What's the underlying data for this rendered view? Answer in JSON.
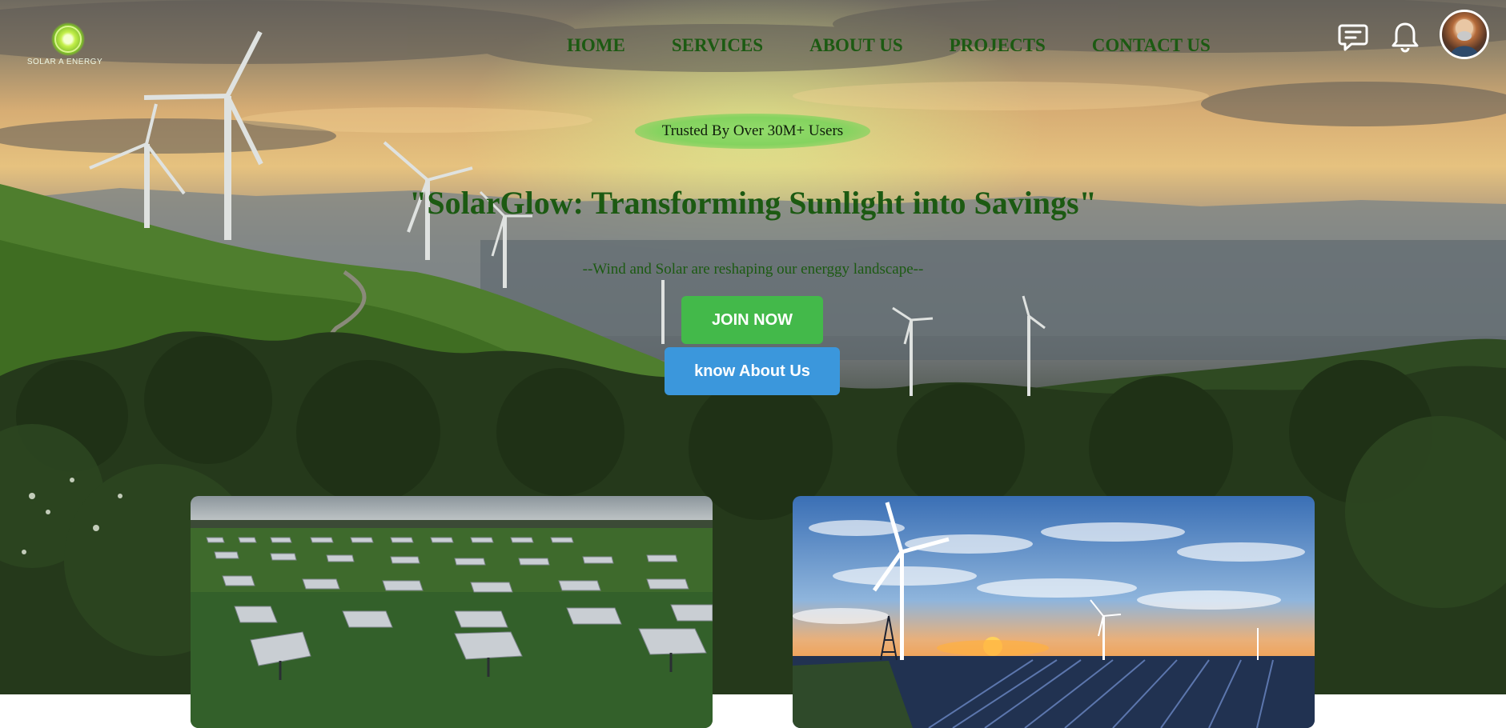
{
  "brand": {
    "logo_text": "SOLAR A ENERGY"
  },
  "nav": {
    "items": [
      {
        "label": "HOME"
      },
      {
        "label": "SERVICES"
      },
      {
        "label": "ABOUT US"
      },
      {
        "label": "PROJECTS"
      },
      {
        "label": "CONTACT US"
      }
    ]
  },
  "header_icons": [
    "message-icon",
    "bell-icon",
    "avatar"
  ],
  "hero": {
    "badge": "Trusted By Over 30M+ Users",
    "headline": "\"SolarGlow: Transforming Sunlight into Savings\"",
    "subline": "--Wind and Solar are reshaping our energgy landscape--",
    "join_label": "JOIN NOW",
    "know_label": "know About Us"
  },
  "cards": [
    {
      "name": "solar-farm-image"
    },
    {
      "name": "wind-solar-sunset-image"
    }
  ],
  "colors": {
    "nav_text": "#1c5a12",
    "headline": "#1c5a12",
    "badge_bg": "#84d35f",
    "join_button": "#43b94a",
    "know_button": "#3b97dc"
  }
}
